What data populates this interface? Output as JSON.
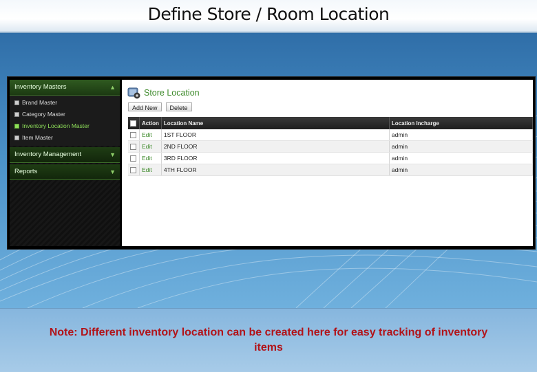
{
  "slide": {
    "title": "Define Store / Room Location",
    "note": "Note: Different inventory location can be created here for easy tracking of inventory items"
  },
  "sidebar": {
    "sections": [
      {
        "label": "Inventory Masters",
        "expanded": true,
        "items": [
          {
            "label": "Brand Master",
            "active": false
          },
          {
            "label": "Category Master",
            "active": false
          },
          {
            "label": "Inventory Location Master",
            "active": true
          },
          {
            "label": "Item Master",
            "active": false
          }
        ]
      },
      {
        "label": "Inventory Management",
        "expanded": false
      },
      {
        "label": "Reports",
        "expanded": false
      }
    ]
  },
  "content": {
    "title": "Store Location",
    "icon": "store-location-icon",
    "toolbar": {
      "add_label": "Add New",
      "delete_label": "Delete"
    },
    "table": {
      "columns": [
        "Action",
        "Location Name",
        "Location Incharge"
      ],
      "rows": [
        {
          "action": "Edit",
          "name": "1ST FLOOR",
          "incharge": "admin"
        },
        {
          "action": "Edit",
          "name": "2ND FLOOR",
          "incharge": "admin"
        },
        {
          "action": "Edit",
          "name": "3RD FLOOR",
          "incharge": "admin"
        },
        {
          "action": "Edit",
          "name": "4TH FLOOR",
          "incharge": "admin"
        }
      ]
    }
  },
  "colors": {
    "accent_green": "#3d8a2a",
    "note_red": "#b1141a",
    "background_blue": "#3f86c0"
  }
}
